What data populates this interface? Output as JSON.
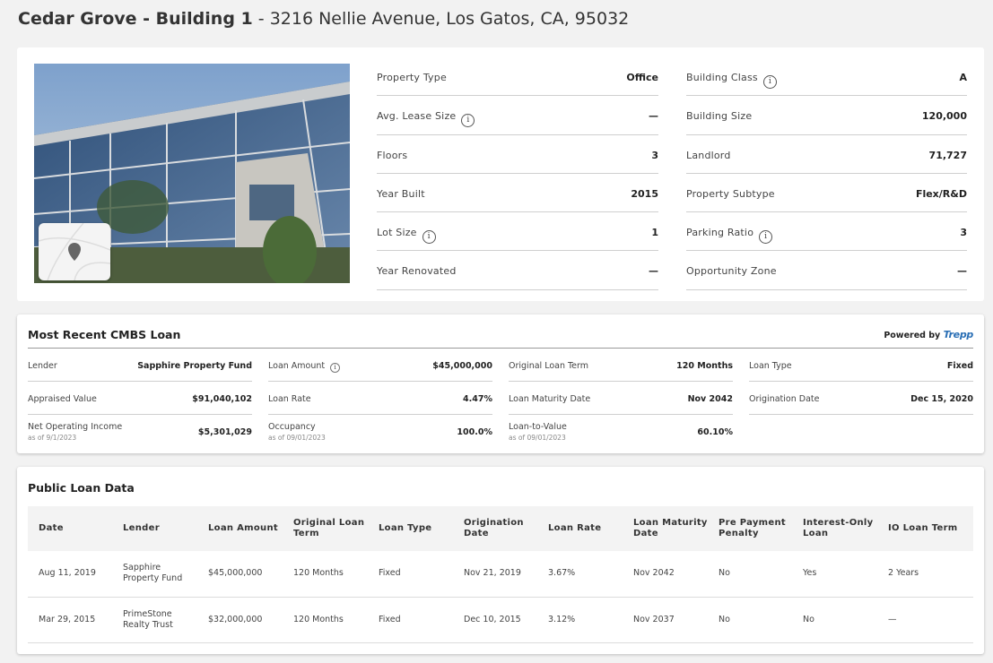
{
  "header": {
    "building_name": "Cedar Grove - Building 1",
    "address": " - 3216 Nellie Avenue, Los Gatos, CA, 95032"
  },
  "property": {
    "left": [
      {
        "label": "Property Type",
        "value": "Office",
        "info": false
      },
      {
        "label": "Avg. Lease Size",
        "value": "—",
        "info": true
      },
      {
        "label": "Floors",
        "value": "3",
        "info": false
      },
      {
        "label": "Year Built",
        "value": "2015",
        "info": false
      },
      {
        "label": "Lot Size",
        "value": "1",
        "info": true
      },
      {
        "label": "Year Renovated",
        "value": "—",
        "info": false
      }
    ],
    "right": [
      {
        "label": "Building Class",
        "value": "A",
        "info": true
      },
      {
        "label": "Building Size",
        "value": "120,000",
        "info": false
      },
      {
        "label": "Landlord",
        "value": "71,727",
        "info": false
      },
      {
        "label": "Property Subtype",
        "value": "Flex/R&D",
        "info": false
      },
      {
        "label": "Parking Ratio",
        "value": "3",
        "info": true
      },
      {
        "label": "Opportunity Zone",
        "value": "—",
        "info": false
      }
    ]
  },
  "cmbs": {
    "title": "Most Recent CMBS Loan",
    "powered_by": "Powered by",
    "brand": "Trepp",
    "rows": [
      [
        {
          "label": "Lender",
          "value": "Sapphire Property Fund"
        },
        {
          "label": "Loan Amount",
          "value": "$45,000,000",
          "info": true
        },
        {
          "label": "Original Loan Term",
          "value": "120 Months"
        },
        {
          "label": "Loan Type",
          "value": "Fixed"
        }
      ],
      [
        {
          "label": "Appraised Value",
          "value": "$91,040,102"
        },
        {
          "label": "Loan Rate",
          "value": "4.47%"
        },
        {
          "label": "Loan Maturity Date",
          "value": "Nov 2042"
        },
        {
          "label": "Origination Date",
          "value": "Dec 15, 2020"
        }
      ],
      [
        {
          "label": "Net Operating Income",
          "sub": "as of 9/1/2023",
          "value": "$5,301,029"
        },
        {
          "label": "Occupancy",
          "sub": "as of 09/01/2023",
          "value": "100.0%"
        },
        {
          "label": "Loan-to-Value",
          "sub": "as of 09/01/2023",
          "value": "60.10%"
        }
      ]
    ]
  },
  "public_loans": {
    "title": "Public Loan Data",
    "columns": [
      "Date",
      "Lender",
      "Loan Amount",
      "Original Loan Term",
      "Loan Type",
      "Origination Date",
      "Loan Rate",
      "Loan Maturity Date",
      "Pre Payment Penalty",
      "Interest-Only Loan",
      "IO Loan Term"
    ],
    "rows": [
      [
        "Aug 11, 2019",
        "Sapphire Property Fund",
        "$45,000,000",
        "120 Months",
        "Fixed",
        "Nov 21, 2019",
        "3.67%",
        "Nov 2042",
        "No",
        "Yes",
        "2 Years"
      ],
      [
        "Mar 29, 2015",
        "PrimeStone Realty Trust",
        "$32,000,000",
        "120 Months",
        "Fixed",
        "Dec 10, 2015",
        "3.12%",
        "Nov 2037",
        "No",
        "No",
        "—"
      ]
    ]
  },
  "icons": {
    "info": "info-icon",
    "map_pin": "map-pin-icon"
  }
}
